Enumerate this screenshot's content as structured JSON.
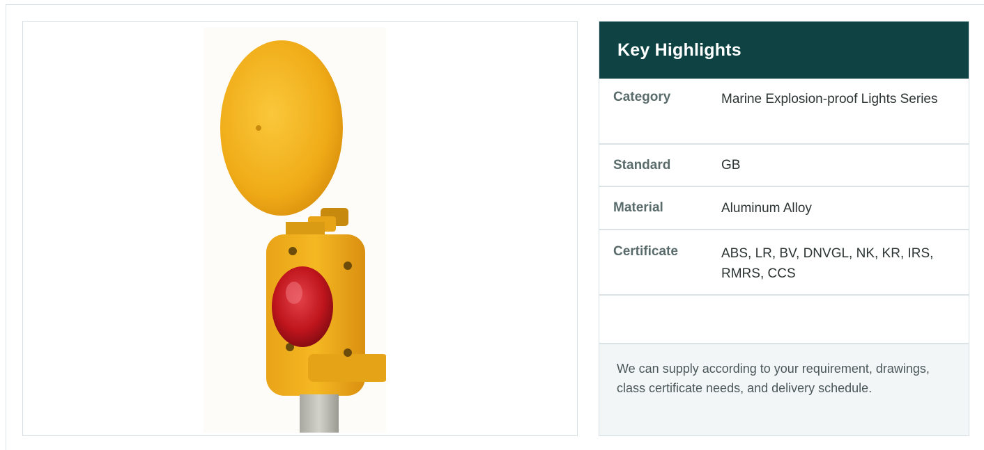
{
  "highlights": {
    "title": "Key Highlights",
    "rows": [
      {
        "label": "Category",
        "value": "Marine Explosion-proof Lights Series"
      },
      {
        "label": "Standard",
        "value": "GB"
      },
      {
        "label": "Material",
        "value": "Aluminum Alloy"
      },
      {
        "label": "Certificate",
        "value": "ABS, LR, BV, DNVGL, NK, KR, IRS, RMRS, CCS"
      },
      {
        "label": "",
        "value": ""
      }
    ],
    "note": "We can supply according to your requirement, drawings, class certificate needs, and delivery schedule."
  },
  "product_image": {
    "icon": "explosion-proof-signal-light-image",
    "colors": {
      "housing": "#f2b21c",
      "lens": "#c4161c",
      "base": "#b8b8b0",
      "header": "#0f4343"
    }
  }
}
